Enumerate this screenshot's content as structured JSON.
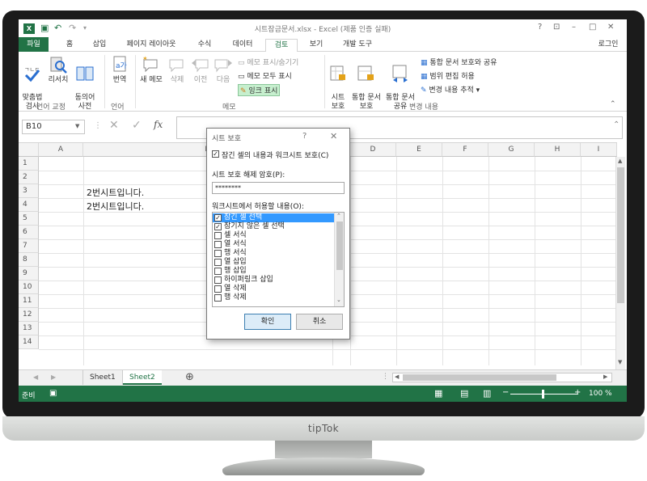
{
  "window": {
    "title": "시트잠금문서.xlsx - Excel (제품 인증 실패)",
    "help": "?",
    "login": "로그인"
  },
  "tabs": [
    "파일",
    "홈",
    "삽입",
    "페이지 레이아웃",
    "수식",
    "데이터",
    "검토",
    "보기",
    "개발 도구"
  ],
  "active_tab": "검토",
  "ribbon": {
    "proofing": {
      "spell_label": "맞춤법\n검사",
      "research_label": "리서치",
      "thesaurus_label": "동의어\n사전",
      "group": "언어 교정"
    },
    "language": {
      "translate_label": "번역",
      "group": "언어"
    },
    "comments": {
      "new_label": "새 메모",
      "delete_label": "삭제",
      "prev_label": "이전",
      "next_label": "다음",
      "show_hide": "메모 표시/숨기기",
      "show_all": "메모 모두 표시",
      "show_ink": "잉크 표시",
      "group": "메모"
    },
    "changes": {
      "protect_sheet": "시트\n보호",
      "protect_workbook": "통합 문서\n보호",
      "share_workbook": "통합 문서\n공유",
      "protect_share": "통합 문서 보호와 공유",
      "allow_edit": "범위 편집 허용",
      "track_changes": "변경 내용 추적 ▾",
      "group": "변경 내용"
    }
  },
  "formula_bar": {
    "name_box": "B10",
    "fx": "fx"
  },
  "columns": [
    "A",
    "B",
    "C",
    "D",
    "E",
    "F",
    "G",
    "H",
    "I"
  ],
  "rows": [
    "1",
    "2",
    "3",
    "4",
    "5",
    "6",
    "7",
    "8",
    "9",
    "10",
    "11",
    "12",
    "13",
    "14"
  ],
  "cells": {
    "B3": "2번시트입니다.",
    "B4": "2번시트입니다."
  },
  "sheets": [
    "Sheet1",
    "Sheet2"
  ],
  "active_sheet": "Sheet2",
  "status": {
    "ready": "준비",
    "zoom": "100 %"
  },
  "dialog": {
    "title": "시트 보호",
    "protect_check_label": "잠긴 셀의 내용과 워크시트 보호(C)",
    "password_label": "시트 보호 해제 암호(P):",
    "password_value": "********",
    "permissions_label": "워크시트에서 허용할 내용(O):",
    "permissions": [
      {
        "label": "잠긴 셀 선택",
        "checked": true
      },
      {
        "label": "잠기지 않은 셀 선택",
        "checked": true
      },
      {
        "label": "셀 서식",
        "checked": false
      },
      {
        "label": "열 서식",
        "checked": false
      },
      {
        "label": "행 서식",
        "checked": false
      },
      {
        "label": "열 삽입",
        "checked": false
      },
      {
        "label": "행 삽입",
        "checked": false
      },
      {
        "label": "하이퍼링크 삽입",
        "checked": false
      },
      {
        "label": "열 삭제",
        "checked": false
      },
      {
        "label": "행 삭제",
        "checked": false
      }
    ],
    "ok_label": "확인",
    "cancel_label": "취소"
  },
  "brand": "tipTok",
  "colors": {
    "excel_green": "#217346",
    "selection": "#3399ff"
  }
}
